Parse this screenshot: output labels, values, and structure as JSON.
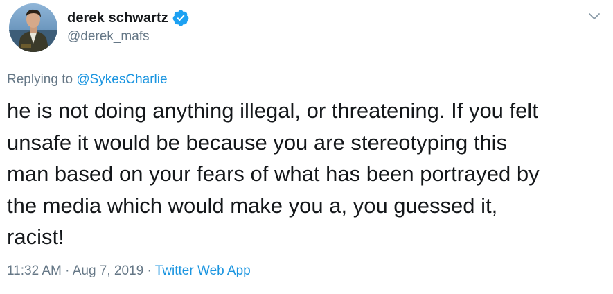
{
  "author": {
    "display_name": "derek schwartz",
    "handle": "@derek_mafs",
    "verified_icon": "verified-badge-icon",
    "avatar_icon": "avatar"
  },
  "colors": {
    "text": "#14171a",
    "secondary": "#657786",
    "link": "#1b95e0",
    "verified": "#1da1f2"
  },
  "reply": {
    "prefix": "Replying to ",
    "mention": "@SykesCharlie"
  },
  "tweet": {
    "text": "he is not doing anything illegal, or threatening. If you felt\nunsafe it would be because you are stereotyping this\nman based on your fears of what has been portrayed by\nthe media which would make you a, you guessed it,\nracist!"
  },
  "meta": {
    "time": "11:32 AM",
    "sep1": " · ",
    "date": "Aug 7, 2019",
    "sep2": " · ",
    "source": "Twitter Web App"
  }
}
